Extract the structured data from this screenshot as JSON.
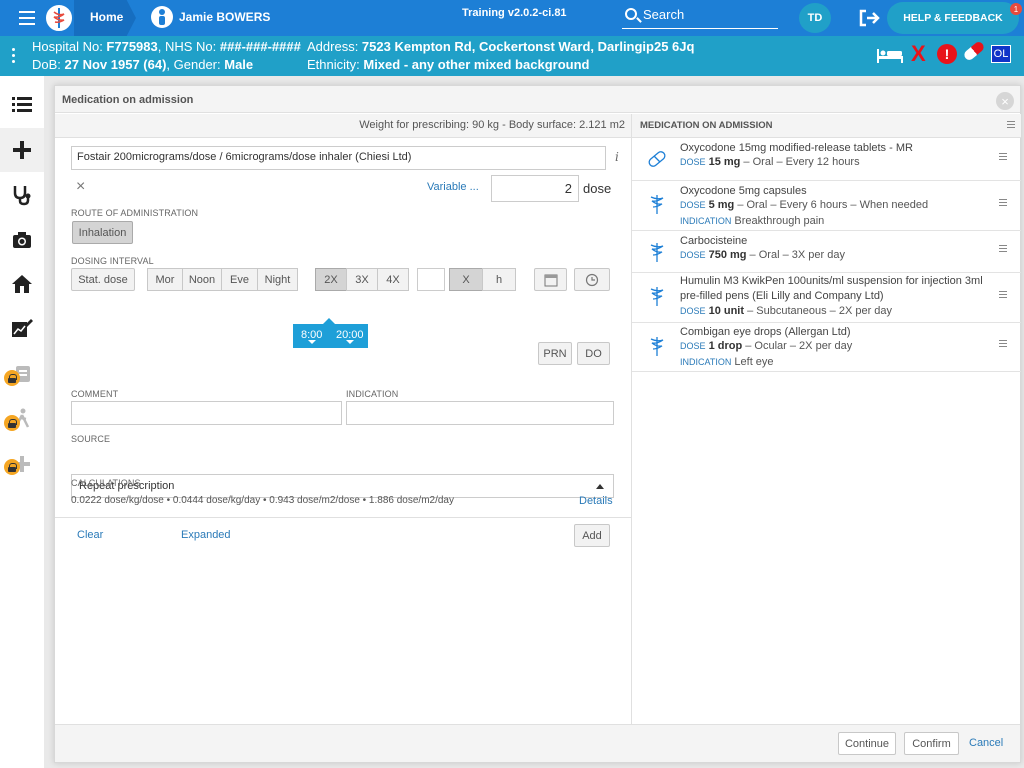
{
  "topbar": {
    "home_label": "Home",
    "patient_name": "Jamie BOWERS",
    "training_label": "Training v2.0.2-ci.81",
    "search_label": "Search",
    "avatar_initials": "TD",
    "help_label": "HELP & FEEDBACK",
    "help_badge": "1",
    "color": "#1d7fd6"
  },
  "banner": {
    "hospital_prefix": "Hospital No: ",
    "hospital_no": "F775983",
    "nhs_prefix": ", NHS No: ",
    "nhs_no": "###-###-####",
    "dob_prefix": "DoB: ",
    "dob": "27 Nov 1957 (64)",
    "gender_prefix": ", Gender: ",
    "gender": "Male",
    "address_prefix": "Address: ",
    "address": "7523 Kempton Rd, Cockertonst Ward, Darlingip25 6Jq",
    "ethnicity_prefix": "Ethnicity: ",
    "ethnicity": "Mixed - any other mixed background",
    "x_icon": "X",
    "alert_icon": "!",
    "ol_badge": "OL",
    "color": "#20a0c8"
  },
  "sidebar": {
    "items": [
      {
        "icon": "list-icon"
      },
      {
        "icon": "plus-icon"
      },
      {
        "icon": "stethoscope-icon"
      },
      {
        "icon": "camera-icon"
      },
      {
        "icon": "home-icon"
      },
      {
        "icon": "edit-chart-icon"
      },
      {
        "icon": "tasks-icon",
        "locked": true
      },
      {
        "icon": "walking-icon",
        "locked": true
      },
      {
        "icon": "add-icon",
        "locked": true
      }
    ]
  },
  "modal": {
    "title": "Medication on admission",
    "close": "×",
    "weight_text": "Weight for prescribing: 90 kg - Body surface: 2.121 m2",
    "drug_value": "Fostair 200micrograms/dose / 6micrograms/dose inhaler (Chiesi Ltd)",
    "info_icon": "i",
    "clear_x": "×",
    "variable_link": "Variable ...",
    "dose_value": "2",
    "dose_unit": "dose",
    "route_label": "ROUTE OF ADMINISTRATION",
    "route_button": "Inhalation",
    "dosing_label": "DOSING INTERVAL",
    "stat_dose": "Stat. dose",
    "times_of_day": [
      "Mor",
      "Noon",
      "Eve",
      "Night"
    ],
    "frequency": [
      "2X",
      "3X",
      "4X"
    ],
    "interval_x": "X",
    "interval_h": "h",
    "time_slots": [
      "8:00",
      "20:00"
    ],
    "prn": "PRN",
    "do": "DO",
    "comment_label": "COMMENT",
    "indication_label": "INDICATION",
    "source_label": "SOURCE",
    "source_value": "Repeat prescription",
    "calculations_label": "CALCULATIONS",
    "calculations": "0.0222 dose/kg/dose • 0.0444 dose/kg/day • 0.943 dose/m2/dose • 1.886 dose/m2/day",
    "details_link": "Details",
    "clear_link": "Clear",
    "expanded_link": "Expanded",
    "add_button": "Add"
  },
  "med_list": {
    "title": "MEDICATION ON ADMISSION",
    "dose_key": "DOSE",
    "indication_key": "INDICATION",
    "items": [
      {
        "name": "Oxycodone 15mg modified-release tablets - MR",
        "dose": "15 mg",
        "details": " – Oral – Every 12 hours",
        "icon": "pill-icon"
      },
      {
        "name": "Oxycodone 5mg capsules",
        "dose": "5 mg",
        "details": " – Oral – Every 6 hours – When needed",
        "indication": "Breakthrough pain",
        "icon": "caduceus-icon"
      },
      {
        "name": "Carbocisteine",
        "dose": "750 mg",
        "details": " – Oral – 3X per day",
        "icon": "caduceus-icon"
      },
      {
        "name": "Humulin M3 KwikPen 100units/ml suspension for injection 3ml pre-filled pens (Eli Lilly and Company Ltd)",
        "dose": "10 unit",
        "details": " – Subcutaneous – 2X per day",
        "icon": "caduceus-icon"
      },
      {
        "name": "Combigan eye drops (Allergan Ltd)",
        "dose": "1 drop",
        "details": " – Ocular – 2X per day",
        "indication": "Left eye",
        "icon": "caduceus-icon"
      }
    ]
  },
  "footer": {
    "continue": "Continue",
    "confirm": "Confirm",
    "cancel": "Cancel"
  }
}
